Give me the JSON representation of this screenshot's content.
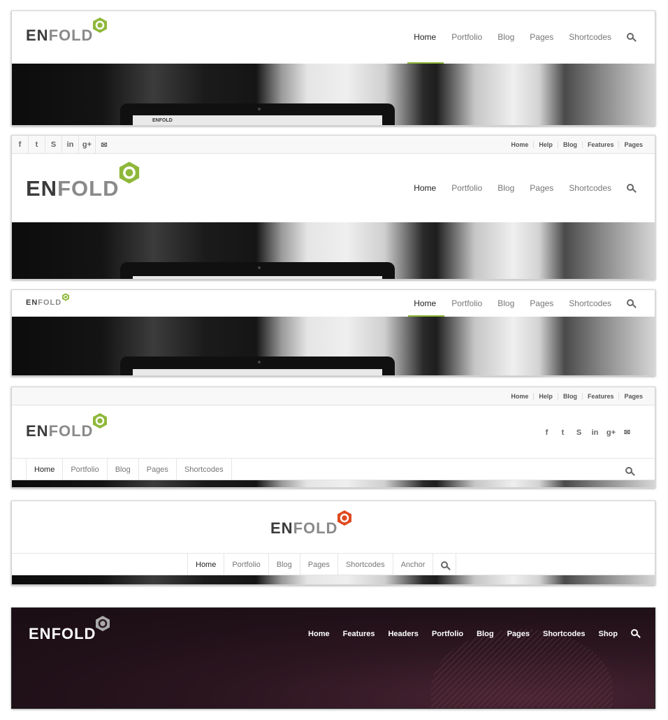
{
  "brand": {
    "logo_en": "EN",
    "logo_fold": "FOLD"
  },
  "colors": {
    "green": "#8fb83b",
    "orange": "#e04a1f",
    "gray_icon": "#aaaaaa"
  },
  "main_nav": [
    "Home",
    "Portfolio",
    "Blog",
    "Pages",
    "Shortcodes"
  ],
  "topbar_links": [
    "Home",
    "Help",
    "Blog",
    "Features",
    "Pages"
  ],
  "social_icons": [
    "f",
    "t",
    "S",
    "in",
    "g+",
    "✉"
  ],
  "panel5_nav": [
    "Home",
    "Portfolio",
    "Blog",
    "Pages",
    "Shortcodes",
    "Anchor"
  ],
  "dark_nav": [
    "Home",
    "Features",
    "Headers",
    "Portfolio",
    "Blog",
    "Pages",
    "Shortcodes",
    "Shop"
  ],
  "laptop_mini": "ENFOLD",
  "icons": {
    "search": "search-icon",
    "logo_mark": "hexagon-logo-icon"
  }
}
